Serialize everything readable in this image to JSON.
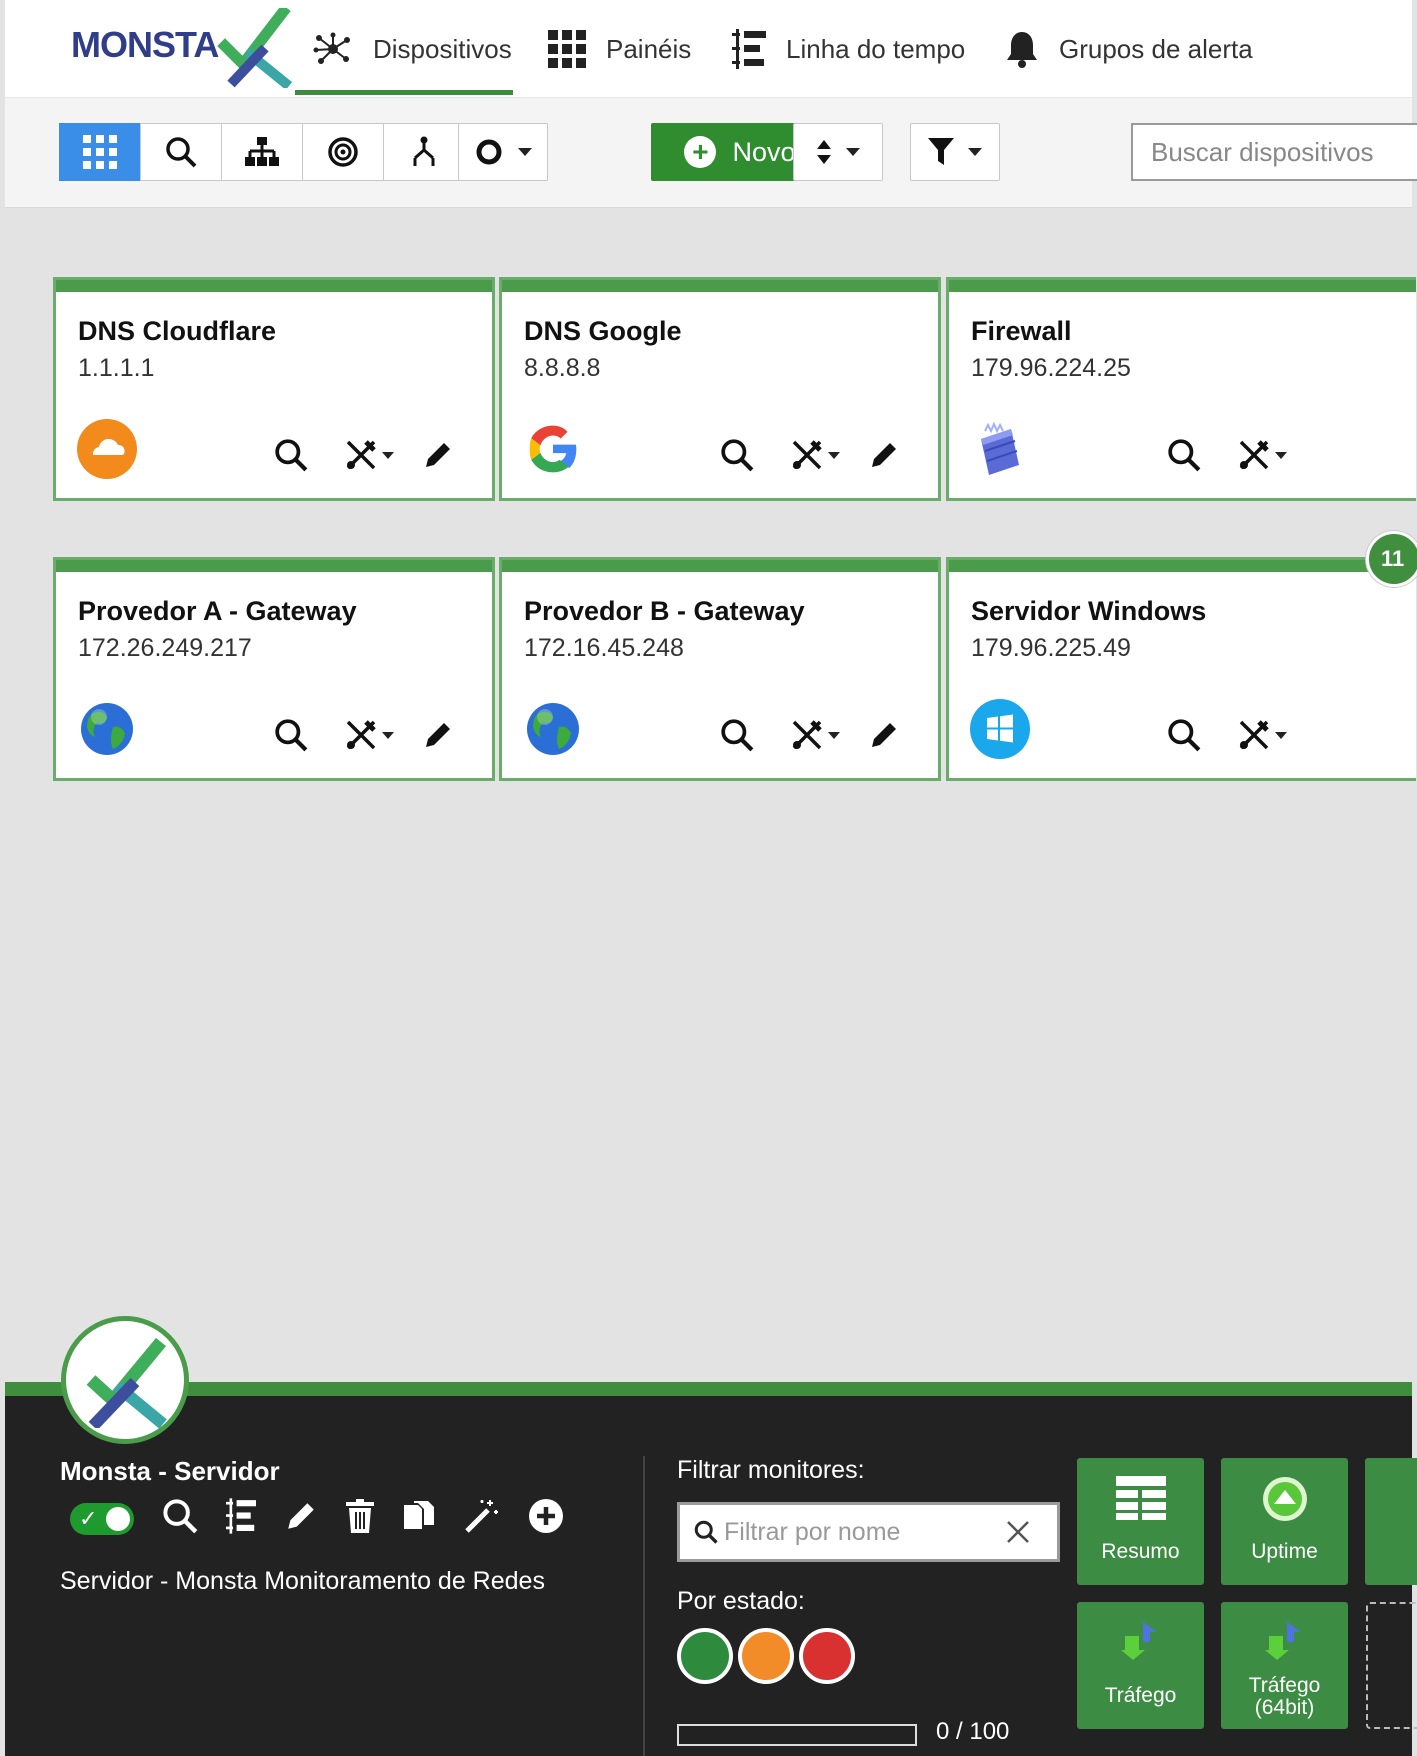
{
  "brand": {
    "logo_text": "MONSTA"
  },
  "nav": [
    {
      "label": "Dispositivos",
      "icon": "network-icon",
      "active": true
    },
    {
      "label": "Painéis",
      "icon": "grid-icon",
      "active": false
    },
    {
      "label": "Linha do tempo",
      "icon": "timeline-icon",
      "active": false
    },
    {
      "label": "Grupos de alerta",
      "icon": "bell-icon",
      "active": false
    }
  ],
  "toolbar": {
    "views": [
      "grid-view",
      "search-view",
      "tree-view",
      "radial-view",
      "hierarchy-view"
    ],
    "new_label": "Novo",
    "search_placeholder": "Buscar dispositivos"
  },
  "devices": [
    {
      "name": "DNS Cloudflare",
      "ip": "1.1.1.1",
      "icon": "cloudflare-icon"
    },
    {
      "name": "DNS Google",
      "ip": "8.8.8.8",
      "icon": "google-icon"
    },
    {
      "name": "Firewall",
      "ip": "179.96.224.25",
      "icon": "firewall-icon"
    },
    {
      "name": "Provedor A - Gateway",
      "ip": "172.26.249.217",
      "icon": "globe-icon"
    },
    {
      "name": "Provedor B - Gateway",
      "ip": "172.16.45.248",
      "icon": "globe-icon"
    },
    {
      "name": "Servidor Windows",
      "ip": "179.96.225.49",
      "icon": "windows-icon",
      "badge": "11"
    }
  ],
  "panel": {
    "server_name": "Monsta - Servidor",
    "description": "Servidor - Monsta Monitoramento de Redes",
    "enabled": true,
    "filter_label": "Filtrar monitores:",
    "filter_placeholder": "Filtrar por nome",
    "state_label": "Por estado:",
    "state_colors": [
      "#2e8b3e",
      "#f28c28",
      "#d93030"
    ],
    "progress_text": "0 / 100",
    "progress_fraction": 0,
    "monitors": [
      {
        "label": "Resumo",
        "icon": "table-icon"
      },
      {
        "label": "Uptime",
        "icon": "uptime-icon"
      },
      {
        "label": "Tráfego",
        "icon": "traffic-icon"
      },
      {
        "label": "Tráfego (64bit)",
        "icon": "traffic-icon"
      }
    ]
  },
  "colors": {
    "brand_green": "#3e8e3e",
    "accent_blue": "#3b8ee8",
    "panel_bg": "#222222"
  }
}
